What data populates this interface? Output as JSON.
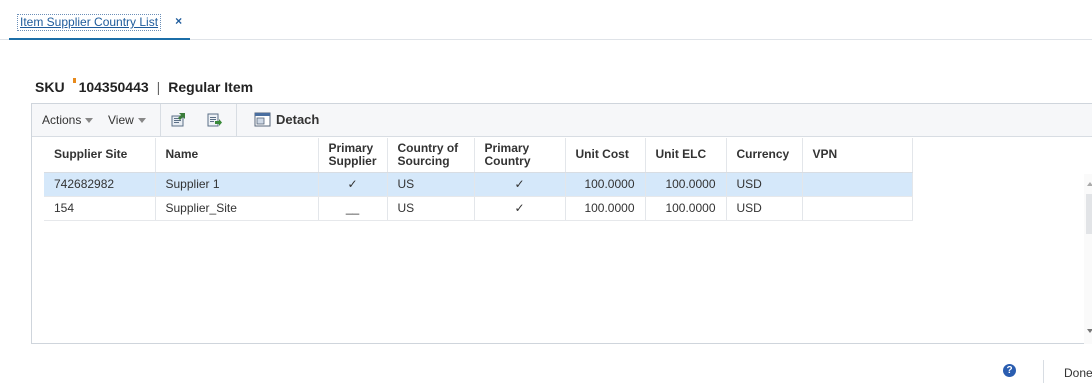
{
  "tab": {
    "title": "Item Supplier Country List",
    "close_label": "×"
  },
  "heading": {
    "sku_label": "SKU",
    "sku_value": "104350443",
    "separator": "|",
    "item_type": "Regular Item"
  },
  "toolbar": {
    "actions_label": "Actions",
    "view_label": "View",
    "detach_label": "Detach",
    "icons": [
      "edit-icon",
      "export-icon",
      "detach-icon"
    ]
  },
  "table": {
    "headers": {
      "supplier_site": "Supplier Site",
      "name": "Name",
      "primary_supplier_1": "Primary",
      "primary_supplier_2": "Supplier",
      "country_of_sourcing_1": "Country of",
      "country_of_sourcing_2": "Sourcing",
      "primary_country_1": "Primary",
      "primary_country_2": "Country",
      "unit_cost": "Unit Cost",
      "unit_elc": "Unit ELC",
      "currency": "Currency",
      "vpn": "VPN"
    },
    "rows": [
      {
        "supplier_site": "742682982",
        "name": "Supplier 1",
        "primary_supplier": "✓",
        "country": "US",
        "primary_country": "✓",
        "unit_cost": "100.0000",
        "unit_elc": "100.0000",
        "currency": "USD",
        "vpn": ""
      },
      {
        "supplier_site": "154",
        "name": "Supplier_Site",
        "primary_supplier": "__",
        "country": "US",
        "primary_country": "✓",
        "unit_cost": "100.0000",
        "unit_elc": "100.0000",
        "currency": "USD",
        "vpn": ""
      }
    ]
  },
  "footer": {
    "help_label": "?",
    "done_label": "Done"
  },
  "colors": {
    "selected_row": "#d5e8fa",
    "accent": "#1b6ea8",
    "required_marker": "#e78a1c"
  }
}
